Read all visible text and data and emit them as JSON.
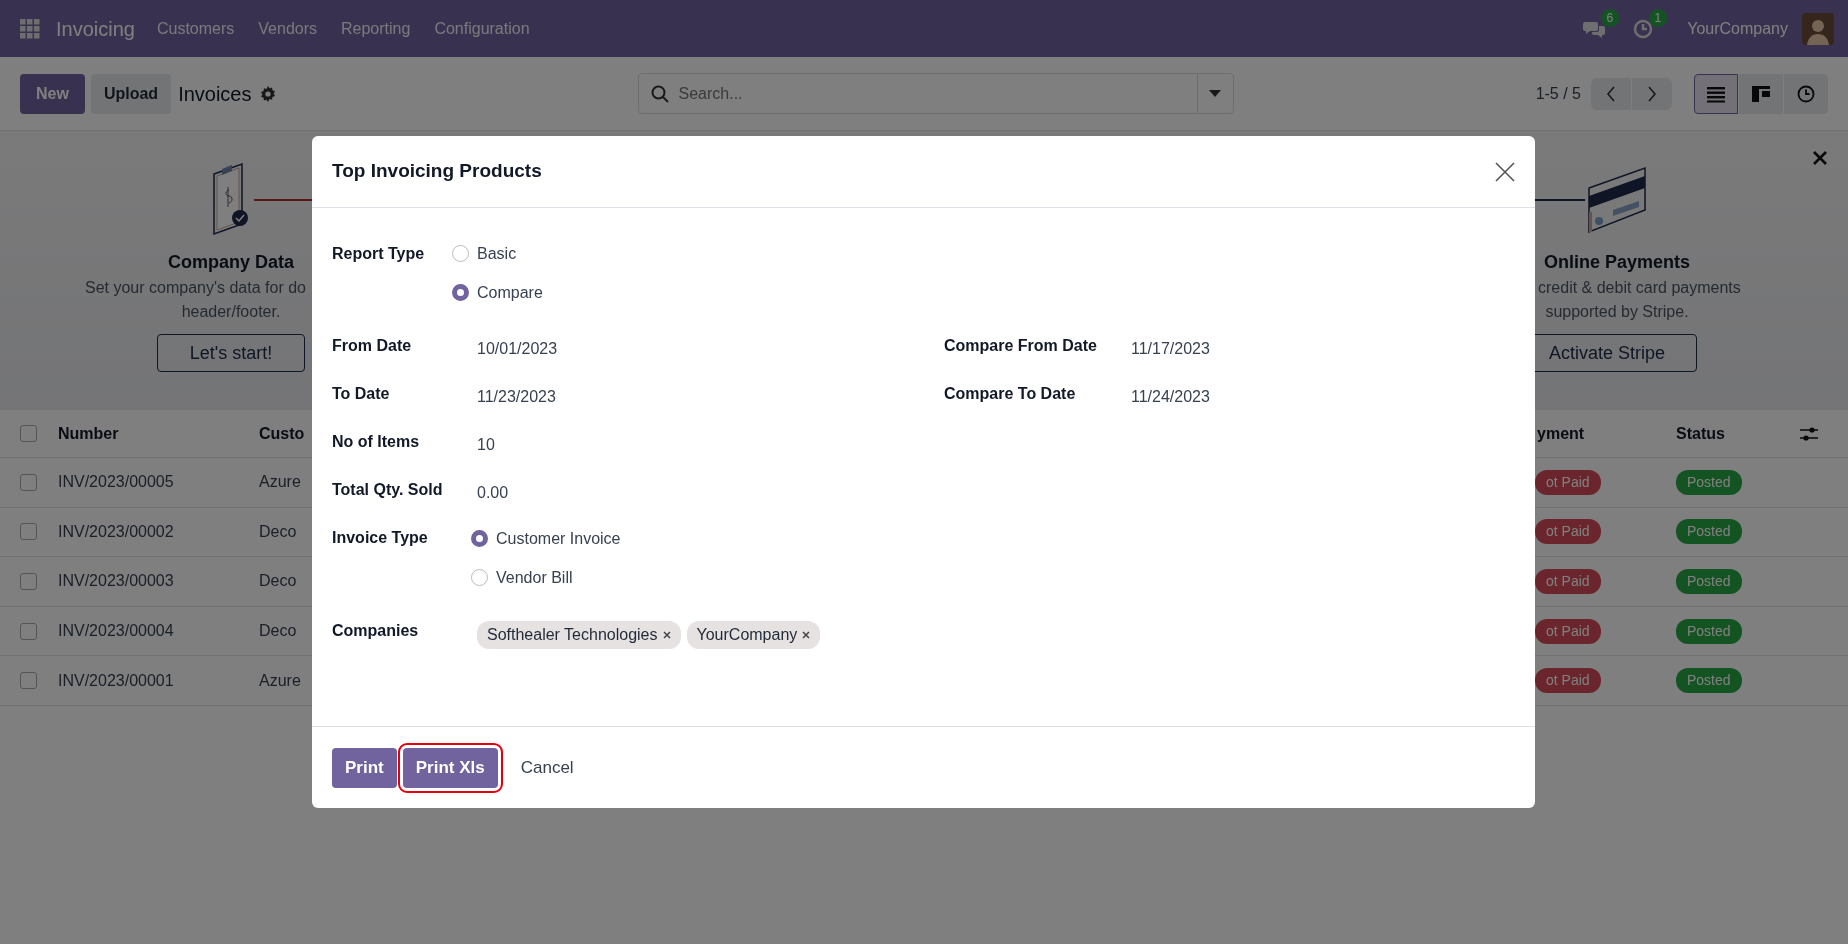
{
  "navbar": {
    "app_name": "Invoicing",
    "menu": [
      "Customers",
      "Vendors",
      "Reporting",
      "Configuration"
    ],
    "messages_count": "6",
    "activities_count": "1",
    "company": "YourCompany"
  },
  "control_panel": {
    "buttons": [
      {
        "label": "New",
        "kind": "primary"
      },
      {
        "label": "Upload",
        "kind": "secondary"
      }
    ],
    "title": "Invoices",
    "search": {
      "placeholder": "Search..."
    },
    "pager": "1-5 / 5",
    "views": [
      {
        "kind": "list",
        "selected": true
      },
      {
        "kind": "kanban",
        "selected": false
      },
      {
        "kind": "activity",
        "selected": false
      }
    ]
  },
  "banner": {
    "steps": [
      {
        "kind": "company",
        "title": "Company Data",
        "lines": [
          "Set your company's data for do",
          "header/footer."
        ],
        "button": "Let's start!"
      },
      {
        "kind": "payment",
        "title": "Online Payments",
        "lines": [
          "credit & debit card payments",
          "supported by Stripe."
        ],
        "button": "Activate Stripe"
      }
    ]
  },
  "table": {
    "header_checked": false,
    "columns": [
      "Number",
      "Custo",
      "yment",
      "Status"
    ],
    "rows": [
      {
        "checked": false,
        "number": "INV/2023/00005",
        "customer": "Azure",
        "payment": "ot Paid",
        "status": "Posted"
      },
      {
        "checked": false,
        "number": "INV/2023/00002",
        "customer": "Deco",
        "payment": "ot Paid",
        "status": "Posted"
      },
      {
        "checked": false,
        "number": "INV/2023/00003",
        "customer": "Deco",
        "payment": "ot Paid",
        "status": "Posted"
      },
      {
        "checked": false,
        "number": "INV/2023/00004",
        "customer": "Deco",
        "payment": "ot Paid",
        "status": "Posted"
      },
      {
        "checked": false,
        "number": "INV/2023/00001",
        "customer": "Azure",
        "payment": "ot Paid",
        "status": "Posted"
      }
    ]
  },
  "dialog": {
    "title": "Top Invoicing Products",
    "report_type": {
      "label": "Report Type",
      "options": [
        {
          "label": "Basic",
          "selected": false
        },
        {
          "label": "Compare",
          "selected": true
        }
      ]
    },
    "left_fields": [
      {
        "kind": "text",
        "label": "From Date",
        "value": "10/01/2023"
      },
      {
        "kind": "text",
        "label": "To Date",
        "value": "11/23/2023"
      },
      {
        "kind": "text",
        "label": "No of Items",
        "value": "10"
      },
      {
        "kind": "text",
        "label": "Total Qty. Sold",
        "value": "0.00"
      },
      {
        "kind": "radio",
        "label": "Invoice Type",
        "options": [
          {
            "label": "Customer Invoice",
            "selected": true
          },
          {
            "label": "Vendor Bill",
            "selected": false
          }
        ]
      },
      {
        "kind": "tags",
        "label": "Companies",
        "tags": [
          "Softhealer Technologies",
          "YourCompany"
        ]
      }
    ],
    "right_fields": [
      {
        "kind": "text",
        "label": "Compare From Date",
        "value": "11/17/2023"
      },
      {
        "kind": "text",
        "label": "Compare To Date",
        "value": "11/24/2023"
      }
    ],
    "buttons": [
      {
        "label": "Print",
        "kind": "primary",
        "highlighted": false
      },
      {
        "label": "Print Xls",
        "kind": "primary",
        "highlighted": true
      },
      {
        "label": "Cancel",
        "kind": "link",
        "highlighted": false
      }
    ]
  }
}
